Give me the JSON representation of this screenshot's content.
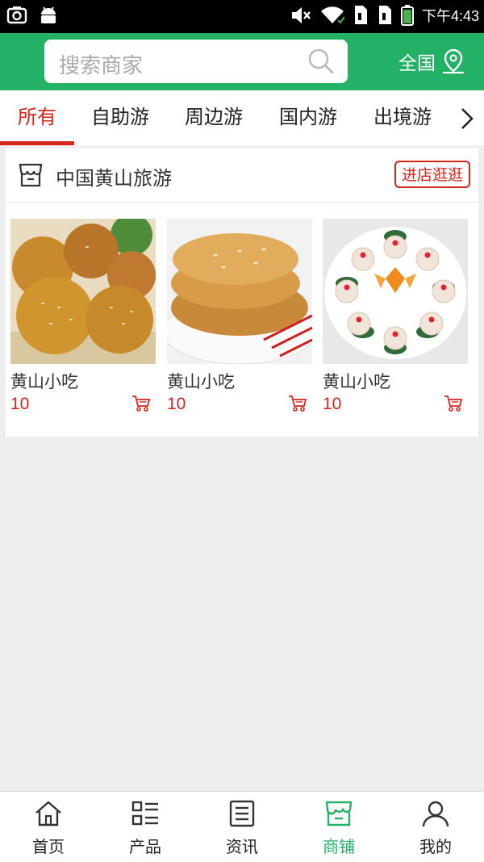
{
  "status_bar": {
    "time": "下午4:43"
  },
  "header": {
    "search_placeholder": "搜索商家",
    "region_label": "全国"
  },
  "tabs": [
    {
      "label": "所有",
      "active": true
    },
    {
      "label": "自助游",
      "active": false
    },
    {
      "label": "周边游",
      "active": false
    },
    {
      "label": "国内游",
      "active": false
    },
    {
      "label": "出境游",
      "active": false
    }
  ],
  "shop": {
    "name": "中国黄山旅游",
    "enter_button": "进店逛逛",
    "products": [
      {
        "name": "黄山小吃",
        "price": "10",
        "image": "sesame-buns"
      },
      {
        "name": "黄山小吃",
        "price": "10",
        "image": "fried-pancakes"
      },
      {
        "name": "黄山小吃",
        "price": "10",
        "image": "dumpling-platter"
      }
    ]
  },
  "bottom_nav": [
    {
      "label": "首页",
      "icon": "home-icon",
      "active": false
    },
    {
      "label": "产品",
      "icon": "product-list-icon",
      "active": false
    },
    {
      "label": "资讯",
      "icon": "news-icon",
      "active": false
    },
    {
      "label": "商铺",
      "icon": "shop-icon",
      "active": true
    },
    {
      "label": "我的",
      "icon": "user-icon",
      "active": false
    }
  ],
  "colors": {
    "brand_green": "#23b165",
    "accent_red": "#d7251b"
  }
}
